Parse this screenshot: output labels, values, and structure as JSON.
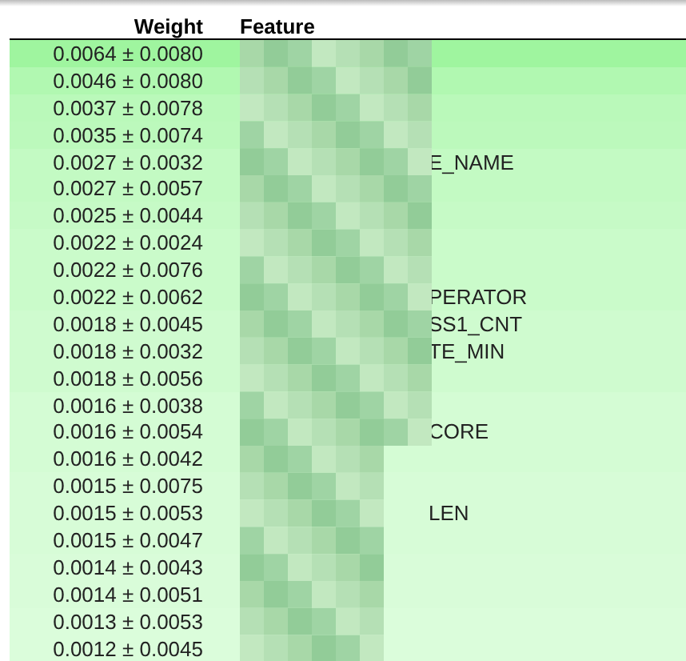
{
  "table": {
    "columns": [
      "Weight",
      "Feature"
    ],
    "rows": [
      {
        "weight": "0.0064 ± 0.0080",
        "feature": "",
        "color": "#9ff59f"
      },
      {
        "weight": "0.0046 ± 0.0080",
        "feature": "",
        "color": "#b1f8b1"
      },
      {
        "weight": "0.0037 ± 0.0078",
        "feature": "",
        "color": "#baf9ba"
      },
      {
        "weight": "0.0035 ± 0.0074",
        "feature": "",
        "color": "#bcf9bc"
      },
      {
        "weight": "0.0027 ± 0.0032",
        "feature": "E_NAME",
        "color": "#c3fac3"
      },
      {
        "weight": "0.0027 ± 0.0057",
        "feature": "",
        "color": "#c3fac3"
      },
      {
        "weight": "0.0025 ± 0.0044",
        "feature": "",
        "color": "#c6fac6"
      },
      {
        "weight": "0.0022 ± 0.0024",
        "feature": "",
        "color": "#cafbca"
      },
      {
        "weight": "0.0022 ± 0.0076",
        "feature": "",
        "color": "#cafbca"
      },
      {
        "weight": "0.0022 ± 0.0062",
        "feature": "PERATOR",
        "color": "#cafbca"
      },
      {
        "weight": "0.0018 ± 0.0045",
        "feature": "SS1_CNT",
        "color": "#cffbcf"
      },
      {
        "weight": "0.0018 ± 0.0032",
        "feature": "TE_MIN",
        "color": "#cffbcf"
      },
      {
        "weight": "0.0018 ± 0.0056",
        "feature": "",
        "color": "#cffbcf"
      },
      {
        "weight": "0.0016 ± 0.0038",
        "feature": "",
        "color": "#d4fcd4"
      },
      {
        "weight": "0.0016 ± 0.0054",
        "feature": "CORE",
        "color": "#d4fcd4"
      },
      {
        "weight": "0.0016 ± 0.0042",
        "feature": "",
        "color": "#d4fcd4"
      },
      {
        "weight": "0.0015 ± 0.0075",
        "feature": "",
        "color": "#d7fcd7"
      },
      {
        "weight": "0.0015 ± 0.0053",
        "feature": "LEN",
        "color": "#d7fcd7"
      },
      {
        "weight": "0.0015 ± 0.0047",
        "feature": "",
        "color": "#d7fcd7"
      },
      {
        "weight": "0.0014 ± 0.0043",
        "feature": "",
        "color": "#d9fcd9"
      },
      {
        "weight": "0.0014 ± 0.0051",
        "feature": "",
        "color": "#d9fcd9"
      },
      {
        "weight": "0.0013 ± 0.0053",
        "feature": "",
        "color": "#dbfddb"
      },
      {
        "weight": "0.0012 ± 0.0045",
        "feature": "",
        "color": "#dbfddb"
      }
    ]
  }
}
